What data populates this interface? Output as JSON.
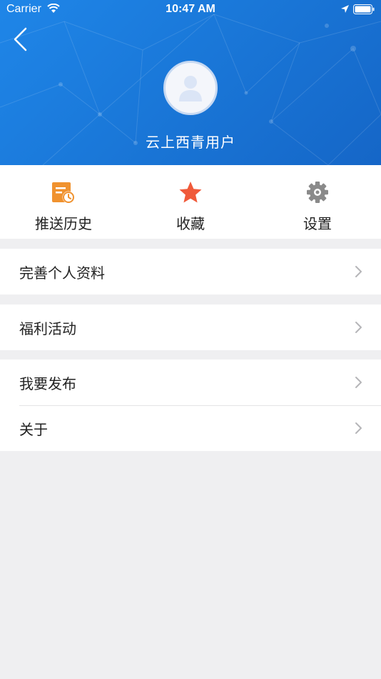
{
  "status_bar": {
    "carrier": "Carrier",
    "time": "10:47 AM"
  },
  "profile": {
    "username": "云上西青用户"
  },
  "shortcuts": [
    {
      "label": "推送历史",
      "icon": "push-history-icon",
      "color": "#f0922f"
    },
    {
      "label": "收藏",
      "icon": "star-icon",
      "color": "#f05a3a"
    },
    {
      "label": "设置",
      "icon": "gear-icon",
      "color": "#8a8a8a"
    }
  ],
  "menu": {
    "complete_profile": "完善个人资料",
    "benefits": "福利活动",
    "publish": "我要发布",
    "about": "关于"
  },
  "colors": {
    "header_blue": "#1a78d9",
    "background": "#efeff1"
  }
}
